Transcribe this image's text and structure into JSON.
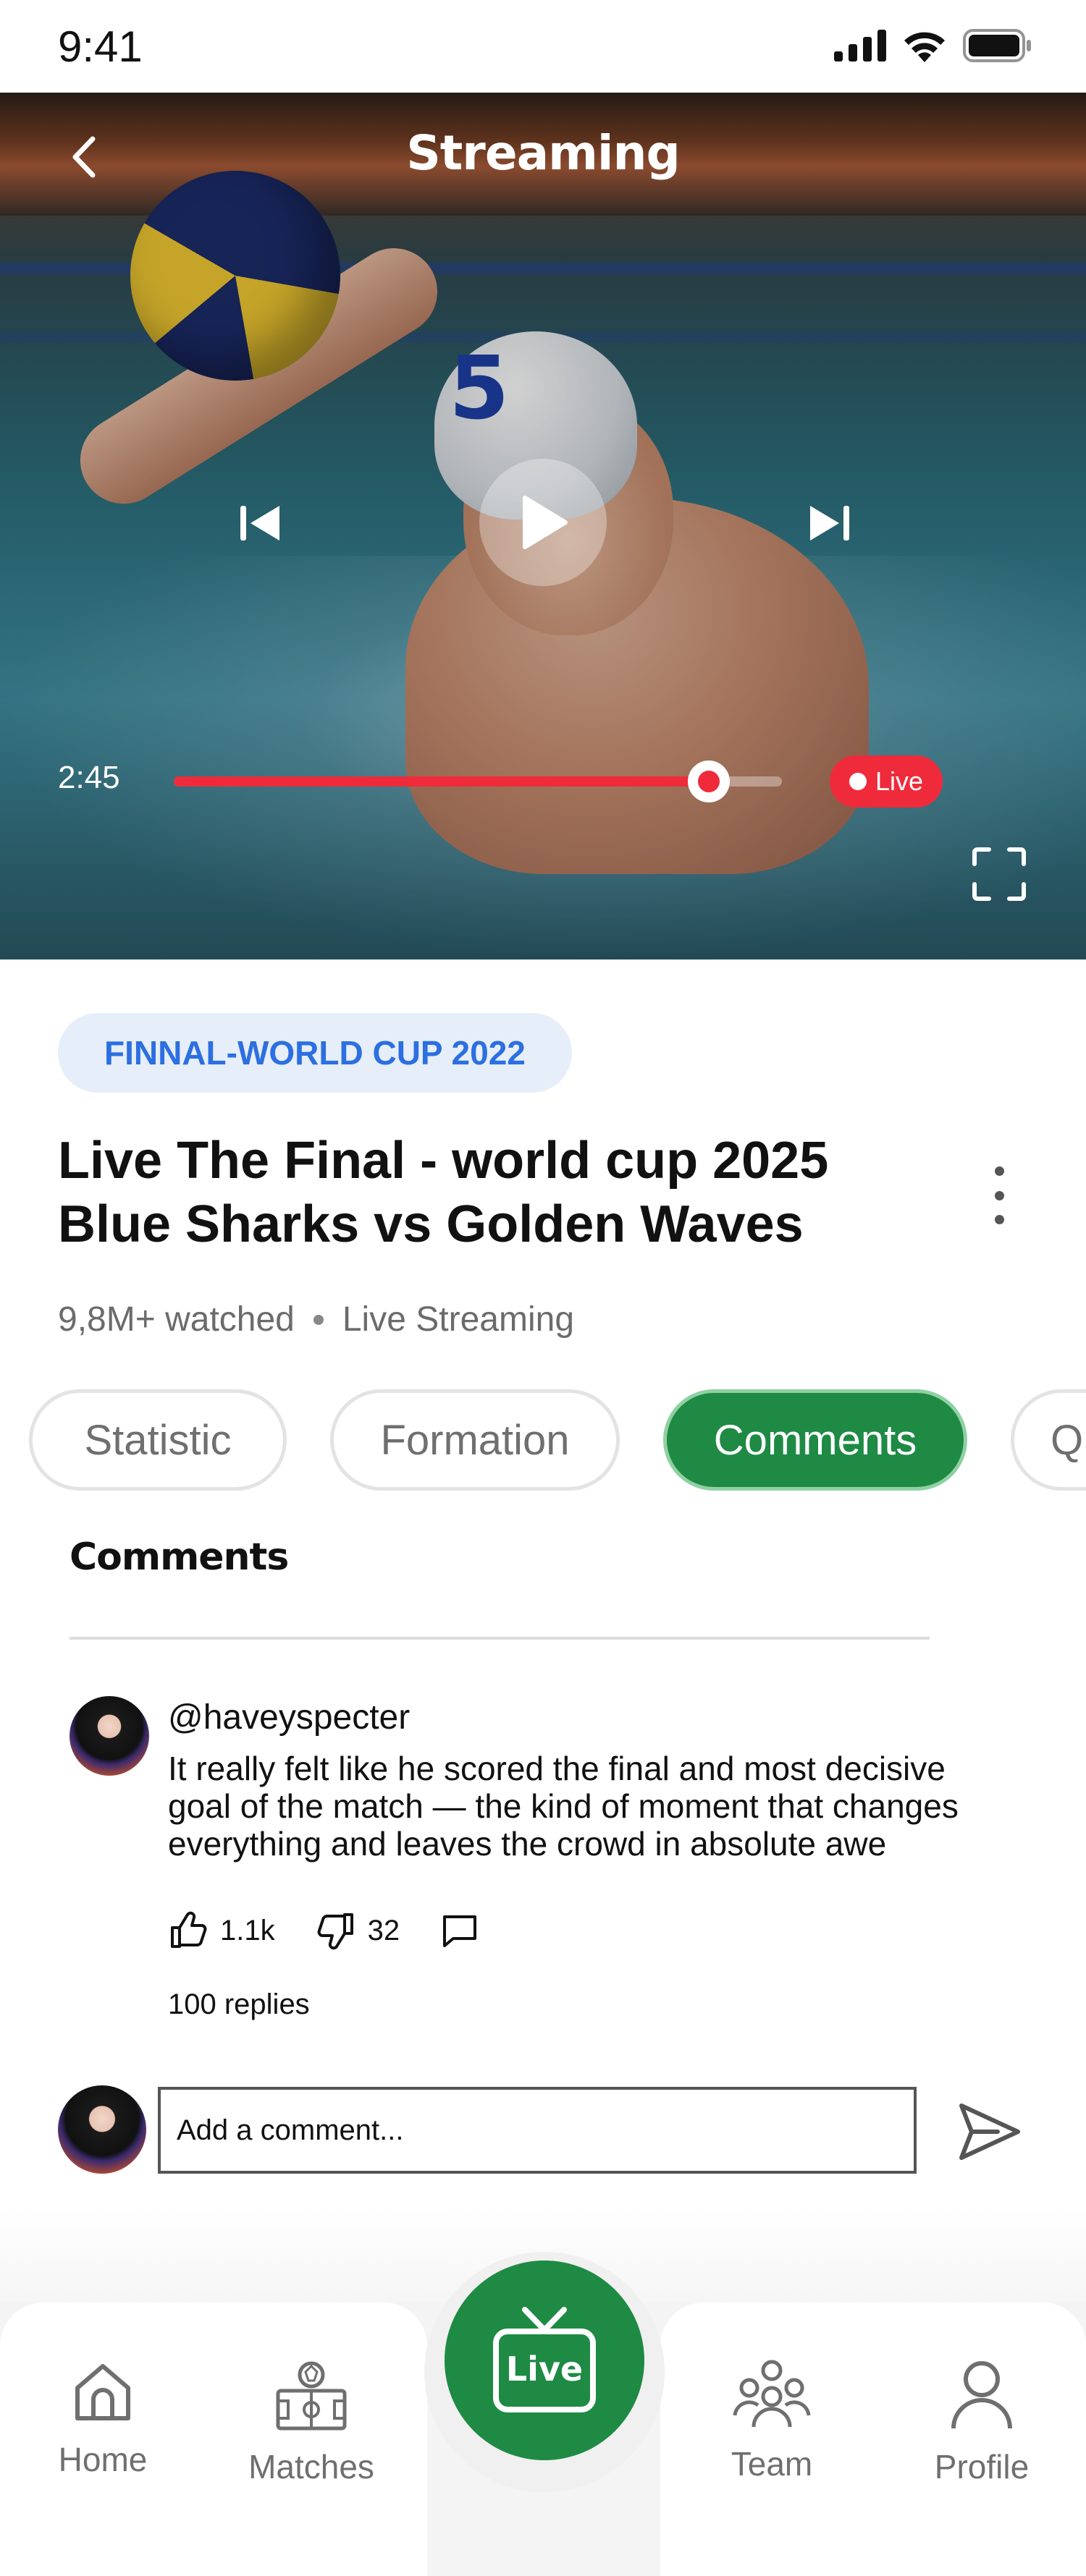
{
  "status_bar": {
    "time": "9:41"
  },
  "video": {
    "title": "Streaming",
    "jersey_number": "5",
    "elapsed": "2:45",
    "progress": 0.88,
    "live_label": "Live"
  },
  "match": {
    "tag": "FINNAL-WORLD CUP 2022",
    "title_line1": "Live The Final - world cup 2025",
    "title_line2": "Blue Sharks vs Golden Waves",
    "watched": "9,8M+ watched",
    "stream_type": "Live Streaming"
  },
  "tabs": [
    {
      "label": "Statistic",
      "active": false
    },
    {
      "label": "Formation",
      "active": false
    },
    {
      "label": "Comments",
      "active": true
    },
    {
      "label": "Q",
      "active": false
    }
  ],
  "comments_section": {
    "heading": "Comments",
    "comment": {
      "username": "@haveyspecter",
      "text": "It really felt like he scored the final and most decisive goal of the match — the kind of moment that changes everything and leaves the crowd in absolute awe",
      "likes": "1.1k",
      "dislikes": "32",
      "replies": "100 replies"
    },
    "composer_placeholder": "Add a comment..."
  },
  "bottom_nav": {
    "home": "Home",
    "matches": "Matches",
    "live": "Live",
    "team": "Team",
    "profile": "Profile"
  },
  "colors": {
    "accent_green": "#1e8a44",
    "live_red": "#ef2b3b",
    "tag_blue": "#2c6fe0",
    "tag_bg": "#e6eefa"
  }
}
